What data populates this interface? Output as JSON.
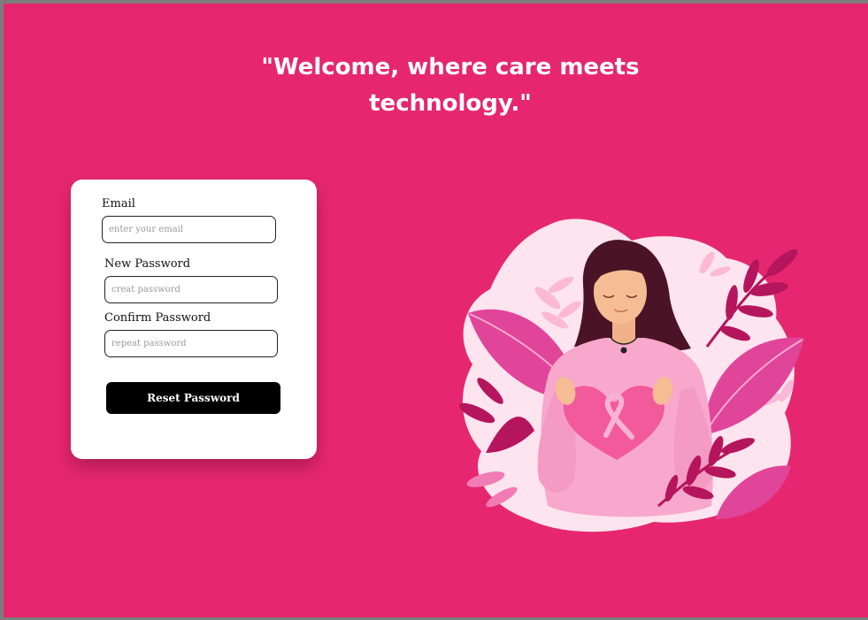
{
  "hero": {
    "headline_line1": "\"Welcome, where care meets",
    "headline_line2": "technology.\""
  },
  "form": {
    "email": {
      "label": "Email",
      "placeholder": "enter your email",
      "value": ""
    },
    "new_password": {
      "label": "New Password",
      "placeholder": "creat password",
      "value": ""
    },
    "confirm_password": {
      "label": "Confirm Password",
      "placeholder": "repeat password",
      "value": ""
    },
    "submit_label": "Reset Password"
  },
  "illustration": {
    "subject": "woman-holding-heart-with-pink-ribbon-illustration"
  },
  "colors": {
    "background": "#e6276f",
    "card": "#ffffff",
    "button": "#000000",
    "blob": "#fde4ee",
    "leaf_dark": "#b5155c",
    "leaf_mid": "#e0459a",
    "heart": "#f25a9c"
  }
}
